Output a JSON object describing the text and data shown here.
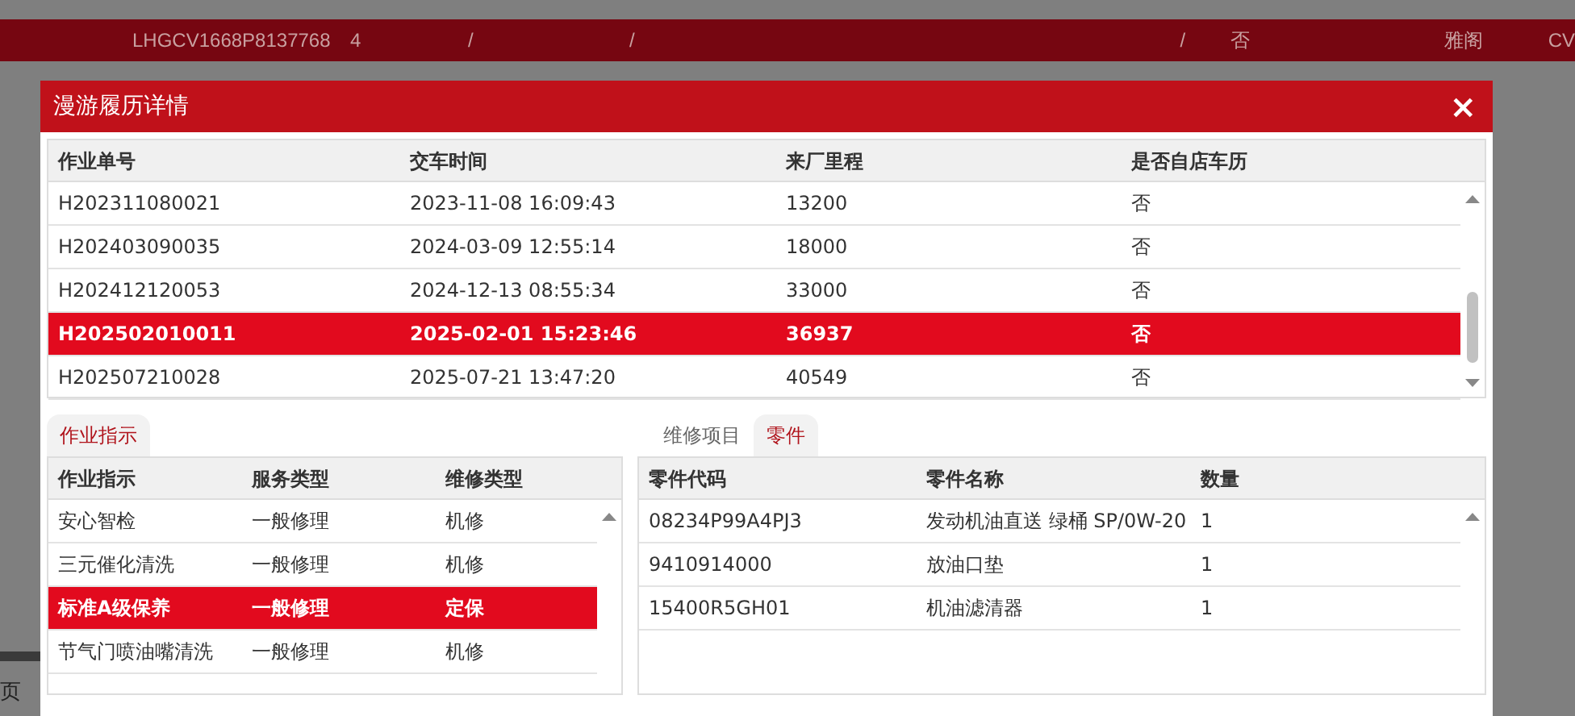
{
  "background_row": {
    "cells": [
      "LHGCV1668P8137768",
      "4",
      "/",
      "/",
      "/",
      "否",
      "雅阁",
      "CV"
    ]
  },
  "background_pager": {
    "label": "页"
  },
  "dialog": {
    "title": "漫游履历详情",
    "close": "×"
  },
  "history_table": {
    "columns": [
      "作业单号",
      "交车时间",
      "来厂里程",
      "是否自店车历"
    ],
    "rows": [
      {
        "cells": [
          "H202311080021",
          "2023-11-08 16:09:43",
          "13200",
          "否"
        ],
        "selected": false
      },
      {
        "cells": [
          "H202403090035",
          "2024-03-09 12:55:14",
          "18000",
          "否"
        ],
        "selected": false
      },
      {
        "cells": [
          "H202412120053",
          "2024-12-13 08:55:34",
          "33000",
          "否"
        ],
        "selected": false
      },
      {
        "cells": [
          "H202502010011",
          "2025-02-01 15:23:46",
          "36937",
          "否"
        ],
        "selected": true
      },
      {
        "cells": [
          "H202507210028",
          "2025-07-21 13:47:20",
          "40549",
          "否"
        ],
        "selected": false
      }
    ]
  },
  "left_tabs": [
    {
      "label": "作业指示",
      "selected": true
    }
  ],
  "instruction_table": {
    "columns": [
      "作业指示",
      "服务类型",
      "维修类型"
    ],
    "rows": [
      {
        "cells": [
          "安心智检",
          "一般修理",
          "机修"
        ],
        "selected": false
      },
      {
        "cells": [
          "三元催化清洗",
          "一般修理",
          "机修"
        ],
        "selected": false
      },
      {
        "cells": [
          "标准A级保养",
          "一般修理",
          "定保"
        ],
        "selected": true
      },
      {
        "cells": [
          "节气门喷油嘴清洗",
          "一般修理",
          "机修"
        ],
        "selected": false
      }
    ]
  },
  "right_tabs": [
    {
      "label": "维修项目",
      "selected": false
    },
    {
      "label": "零件",
      "selected": true
    }
  ],
  "parts_table": {
    "columns": [
      "零件代码",
      "零件名称",
      "数量"
    ],
    "rows": [
      {
        "cells": [
          "08234P99A4PJ3",
          "发动机油直送 绿桶 SP/0W-20",
          "1"
        ],
        "selected": false
      },
      {
        "cells": [
          "9410914000",
          "放油口垫",
          "1"
        ],
        "selected": false
      },
      {
        "cells": [
          "15400R5GH01",
          "机油滤清器",
          "1"
        ],
        "selected": false
      }
    ]
  }
}
